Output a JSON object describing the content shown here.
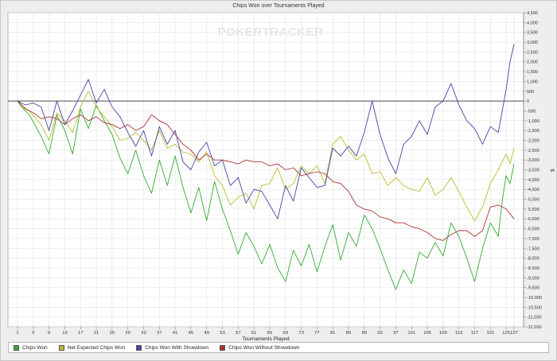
{
  "chart_data": {
    "type": "line",
    "title": "Chips Won over Tournaments Played",
    "xlabel": "Tournaments Played",
    "ylabel": "$",
    "watermark": "POKERTRACKER",
    "xlim": [
      0,
      127
    ],
    "ylim": [
      -11500,
      4500
    ],
    "x_ticks": [
      1,
      5,
      9,
      13,
      17,
      21,
      25,
      29,
      33,
      37,
      41,
      45,
      49,
      53,
      57,
      61,
      65,
      69,
      73,
      77,
      81,
      85,
      89,
      93,
      97,
      101,
      105,
      109,
      113,
      117,
      121,
      125,
      127
    ],
    "y_ticks": [
      4500,
      4000,
      3500,
      3000,
      2500,
      2000,
      1500,
      1000,
      500,
      0,
      -500,
      -1000,
      -1500,
      -2000,
      -2500,
      -3000,
      -3500,
      -4000,
      -4500,
      -5000,
      -5500,
      -6000,
      -6500,
      -7000,
      -7500,
      -8000,
      -8500,
      -9000,
      -9500,
      -10000,
      -10500,
      -11000,
      -11500
    ],
    "y_tick_labels": [
      "4,500",
      "4,000",
      "3,500",
      "3,000",
      "2,500",
      "2,000",
      "1,500",
      "1,000",
      "500",
      "0",
      "-500",
      "-1,000",
      "-1,500",
      "-2,000",
      "-2,500",
      "-3,000",
      "-3,500",
      "-4,000",
      "-4,500",
      "-5,000",
      "-5,500",
      "-6,000",
      "-6,500",
      "-7,000",
      "-7,500",
      "-8,000",
      "-8,500",
      "-9,000",
      "-9,500",
      "-10,000",
      "-10,500",
      "-11,000",
      "-11,500"
    ],
    "grid": true,
    "legend_position": "bottom",
    "series": [
      {
        "name": "Chips Won",
        "color": "#33aa33",
        "points": [
          [
            1,
            0
          ],
          [
            2,
            -300
          ],
          [
            4,
            -700
          ],
          [
            7,
            -1800
          ],
          [
            9,
            -2700
          ],
          [
            11,
            -700
          ],
          [
            13,
            -1500
          ],
          [
            15,
            -2700
          ],
          [
            17,
            -400
          ],
          [
            19,
            -1400
          ],
          [
            21,
            -200
          ],
          [
            23,
            -1000
          ],
          [
            25,
            -1700
          ],
          [
            27,
            -2900
          ],
          [
            29,
            -3700
          ],
          [
            31,
            -2500
          ],
          [
            33,
            -3800
          ],
          [
            35,
            -4700
          ],
          [
            37,
            -3000
          ],
          [
            39,
            -4300
          ],
          [
            41,
            -2800
          ],
          [
            43,
            -4400
          ],
          [
            45,
            -5700
          ],
          [
            47,
            -4400
          ],
          [
            49,
            -6100
          ],
          [
            51,
            -4100
          ],
          [
            53,
            -5500
          ],
          [
            55,
            -6600
          ],
          [
            57,
            -7800
          ],
          [
            59,
            -6700
          ],
          [
            61,
            -7400
          ],
          [
            63,
            -8300
          ],
          [
            65,
            -7300
          ],
          [
            67,
            -8500
          ],
          [
            69,
            -9200
          ],
          [
            71,
            -7600
          ],
          [
            73,
            -8400
          ],
          [
            75,
            -7300
          ],
          [
            77,
            -8700
          ],
          [
            79,
            -7400
          ],
          [
            81,
            -6300
          ],
          [
            83,
            -8100
          ],
          [
            85,
            -6700
          ],
          [
            87,
            -7400
          ],
          [
            89,
            -5800
          ],
          [
            91,
            -6500
          ],
          [
            93,
            -7500
          ],
          [
            95,
            -8600
          ],
          [
            97,
            -9600
          ],
          [
            99,
            -8600
          ],
          [
            101,
            -9300
          ],
          [
            103,
            -7700
          ],
          [
            105,
            -8000
          ],
          [
            107,
            -7200
          ],
          [
            109,
            -7900
          ],
          [
            111,
            -6200
          ],
          [
            113,
            -6900
          ],
          [
            115,
            -8000
          ],
          [
            117,
            -9200
          ],
          [
            119,
            -7500
          ],
          [
            121,
            -6200
          ],
          [
            123,
            -6900
          ],
          [
            124,
            -5100
          ],
          [
            125,
            -3800
          ],
          [
            126,
            -4200
          ],
          [
            127,
            -3200
          ]
        ]
      },
      {
        "name": "Net Expected Chips Won",
        "color": "#bbbb33",
        "points": [
          [
            1,
            0
          ],
          [
            2,
            -200
          ],
          [
            4,
            -500
          ],
          [
            7,
            -1200
          ],
          [
            9,
            -2000
          ],
          [
            11,
            -600
          ],
          [
            13,
            -1000
          ],
          [
            15,
            -1600
          ],
          [
            17,
            -300
          ],
          [
            19,
            500
          ],
          [
            21,
            -300
          ],
          [
            23,
            -800
          ],
          [
            25,
            -1300
          ],
          [
            27,
            -2000
          ],
          [
            29,
            -1900
          ],
          [
            31,
            -1600
          ],
          [
            33,
            -2000
          ],
          [
            35,
            -2500
          ],
          [
            37,
            -1500
          ],
          [
            39,
            -2400
          ],
          [
            41,
            -2200
          ],
          [
            43,
            -2600
          ],
          [
            45,
            -2700
          ],
          [
            47,
            -3100
          ],
          [
            49,
            -2600
          ],
          [
            51,
            -3800
          ],
          [
            53,
            -4300
          ],
          [
            55,
            -5300
          ],
          [
            57,
            -4900
          ],
          [
            59,
            -4700
          ],
          [
            61,
            -5500
          ],
          [
            63,
            -4300
          ],
          [
            65,
            -4200
          ],
          [
            67,
            -3400
          ],
          [
            69,
            -4500
          ],
          [
            71,
            -4200
          ],
          [
            73,
            -3300
          ],
          [
            75,
            -3700
          ],
          [
            77,
            -3300
          ],
          [
            79,
            -4200
          ],
          [
            81,
            -2200
          ],
          [
            83,
            -1800
          ],
          [
            85,
            -2500
          ],
          [
            87,
            -3000
          ],
          [
            89,
            -2700
          ],
          [
            91,
            -3700
          ],
          [
            93,
            -3600
          ],
          [
            95,
            -4300
          ],
          [
            97,
            -3900
          ],
          [
            99,
            -4300
          ],
          [
            101,
            -4500
          ],
          [
            103,
            -4600
          ],
          [
            105,
            -3900
          ],
          [
            107,
            -4800
          ],
          [
            109,
            -4500
          ],
          [
            111,
            -3900
          ],
          [
            113,
            -4600
          ],
          [
            115,
            -5400
          ],
          [
            117,
            -6100
          ],
          [
            119,
            -5400
          ],
          [
            121,
            -4200
          ],
          [
            123,
            -3500
          ],
          [
            125,
            -2700
          ],
          [
            126,
            -3200
          ],
          [
            127,
            -2400
          ]
        ]
      },
      {
        "name": "Chips Won With Showdown",
        "color": "#4444aa",
        "points": [
          [
            1,
            0
          ],
          [
            3,
            -200
          ],
          [
            5,
            -100
          ],
          [
            7,
            -300
          ],
          [
            9,
            -1500
          ],
          [
            11,
            0
          ],
          [
            13,
            -1200
          ],
          [
            15,
            -500
          ],
          [
            17,
            300
          ],
          [
            19,
            1100
          ],
          [
            21,
            -100
          ],
          [
            23,
            600
          ],
          [
            25,
            -300
          ],
          [
            27,
            -800
          ],
          [
            29,
            -1600
          ],
          [
            31,
            -2300
          ],
          [
            33,
            -1500
          ],
          [
            35,
            -2800
          ],
          [
            37,
            -1300
          ],
          [
            39,
            -2200
          ],
          [
            41,
            -1500
          ],
          [
            43,
            -3100
          ],
          [
            45,
            -3500
          ],
          [
            47,
            -2600
          ],
          [
            49,
            -2100
          ],
          [
            51,
            -3300
          ],
          [
            53,
            -3000
          ],
          [
            55,
            -4300
          ],
          [
            57,
            -3900
          ],
          [
            59,
            -5200
          ],
          [
            61,
            -4500
          ],
          [
            63,
            -4600
          ],
          [
            65,
            -5300
          ],
          [
            67,
            -6000
          ],
          [
            69,
            -4300
          ],
          [
            71,
            -5100
          ],
          [
            73,
            -3400
          ],
          [
            75,
            -3900
          ],
          [
            77,
            -4400
          ],
          [
            79,
            -4300
          ],
          [
            81,
            -2400
          ],
          [
            83,
            -2800
          ],
          [
            85,
            -2300
          ],
          [
            87,
            -2800
          ],
          [
            89,
            -1600
          ],
          [
            91,
            0
          ],
          [
            93,
            -1700
          ],
          [
            95,
            -2900
          ],
          [
            97,
            -3700
          ],
          [
            99,
            -2200
          ],
          [
            101,
            -1800
          ],
          [
            103,
            -1000
          ],
          [
            105,
            -1700
          ],
          [
            107,
            -300
          ],
          [
            109,
            0
          ],
          [
            111,
            900
          ],
          [
            113,
            -200
          ],
          [
            115,
            -1000
          ],
          [
            117,
            -1400
          ],
          [
            119,
            -2200
          ],
          [
            121,
            -1300
          ],
          [
            123,
            -1600
          ],
          [
            125,
            600
          ],
          [
            126,
            2000
          ],
          [
            127,
            2900
          ]
        ]
      },
      {
        "name": "Chips Won Without Showdown",
        "color": "#aa3333",
        "points": [
          [
            1,
            0
          ],
          [
            3,
            -400
          ],
          [
            5,
            -600
          ],
          [
            7,
            -900
          ],
          [
            9,
            -800
          ],
          [
            11,
            -900
          ],
          [
            13,
            -1200
          ],
          [
            15,
            -900
          ],
          [
            17,
            -700
          ],
          [
            19,
            -1000
          ],
          [
            21,
            -800
          ],
          [
            23,
            -1100
          ],
          [
            25,
            -1200
          ],
          [
            27,
            -1400
          ],
          [
            29,
            -1200
          ],
          [
            31,
            -1500
          ],
          [
            33,
            -1300
          ],
          [
            35,
            -700
          ],
          [
            37,
            -1000
          ],
          [
            39,
            -1200
          ],
          [
            41,
            -1700
          ],
          [
            43,
            -2200
          ],
          [
            45,
            -2500
          ],
          [
            47,
            -3000
          ],
          [
            49,
            -2700
          ],
          [
            51,
            -3000
          ],
          [
            53,
            -3000
          ],
          [
            55,
            -3100
          ],
          [
            57,
            -3200
          ],
          [
            59,
            -3000
          ],
          [
            61,
            -3100
          ],
          [
            63,
            -3100
          ],
          [
            65,
            -3300
          ],
          [
            67,
            -3200
          ],
          [
            69,
            -3500
          ],
          [
            71,
            -3400
          ],
          [
            73,
            -3800
          ],
          [
            75,
            -3700
          ],
          [
            77,
            -3600
          ],
          [
            79,
            -3700
          ],
          [
            81,
            -4100
          ],
          [
            83,
            -4200
          ],
          [
            85,
            -4600
          ],
          [
            87,
            -5300
          ],
          [
            89,
            -5500
          ],
          [
            91,
            -5600
          ],
          [
            93,
            -5900
          ],
          [
            95,
            -6000
          ],
          [
            97,
            -6200
          ],
          [
            99,
            -6200
          ],
          [
            101,
            -6400
          ],
          [
            103,
            -6500
          ],
          [
            105,
            -6700
          ],
          [
            107,
            -7000
          ],
          [
            109,
            -7100
          ],
          [
            111,
            -6800
          ],
          [
            113,
            -6600
          ],
          [
            115,
            -6600
          ],
          [
            117,
            -6900
          ],
          [
            119,
            -6600
          ],
          [
            121,
            -5400
          ],
          [
            123,
            -5300
          ],
          [
            125,
            -5500
          ],
          [
            127,
            -6000
          ]
        ]
      }
    ]
  }
}
